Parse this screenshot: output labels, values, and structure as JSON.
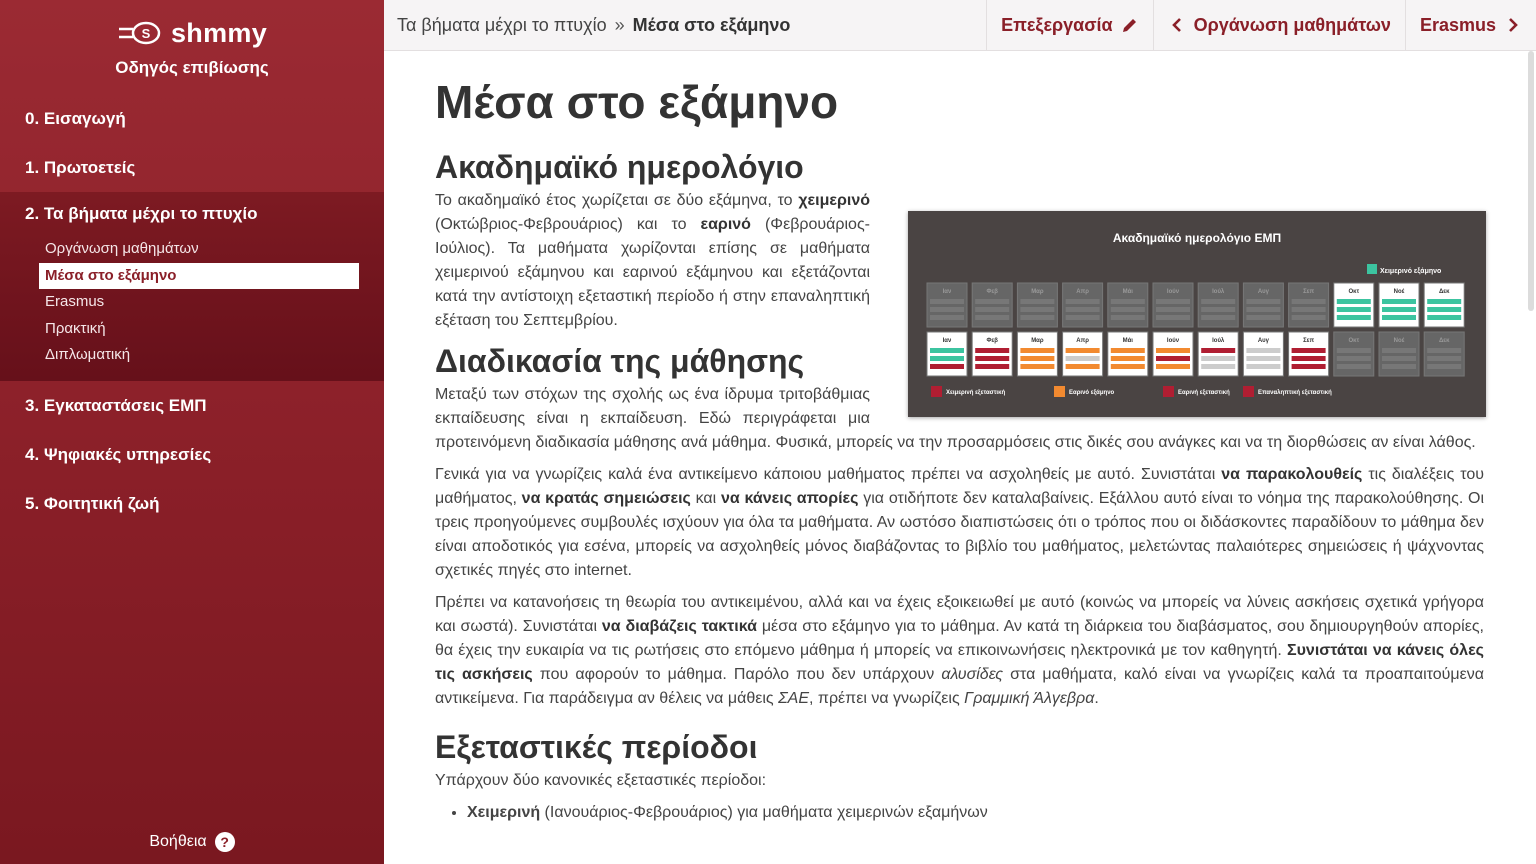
{
  "brand": {
    "name": "shmmy",
    "subtitle": "Οδηγός επιβίωσης"
  },
  "sidebar": {
    "items": [
      {
        "label": "0. Εισαγωγή"
      },
      {
        "label": "1. Πρωτοετείς"
      },
      {
        "label": "2. Τα βήματα μέχρι το πτυχίο",
        "children": [
          {
            "label": "Οργάνωση μαθημάτων"
          },
          {
            "label": "Μέσα στο εξάμηνο",
            "active": true
          },
          {
            "label": "Erasmus"
          },
          {
            "label": "Πρακτική"
          },
          {
            "label": "Διπλωματική"
          }
        ]
      },
      {
        "label": "3. Εγκαταστάσεις ΕΜΠ"
      },
      {
        "label": "4. Ψηφιακές υπηρεσίες"
      },
      {
        "label": "5. Φοιτητική ζωή"
      }
    ],
    "help": "Βοήθεια",
    "help_icon": "question-icon"
  },
  "topbar": {
    "breadcrumb_parent": "Τα βήματα μέχρι το πτυχίο",
    "breadcrumb_sep": "»",
    "breadcrumb_current": "Μέσα στο εξάμηνο",
    "edit": "Επεξεργασία",
    "prev": "Οργάνωση μαθημάτων",
    "next": "Erasmus"
  },
  "colors": {
    "brand": "#8a1f28",
    "teal": "#3cc4a0",
    "orange": "#f28a30",
    "red": "#b01e32"
  },
  "page": {
    "title": "Μέσα στο εξάμηνο",
    "sec1": {
      "heading": "Ακαδημαϊκό ημερολόγιο",
      "p1": [
        "Το ακαδημαϊκό έτος χωρίζεται σε δύο εξάμηνα, το ",
        "χειμερινό",
        " (Οκτώβριος-Φεβρουάριος) και το ",
        "εαρινό",
        " (Φεβρουάριος-Ιούλιος). Τα μαθήματα χωρίζονται επίσης σε μαθήματα χειμερινού εξάμηνου και εαρινού εξάμηνου και εξετάζονται κατά την αντίστοιχη εξεταστική περίοδο ή στην επαναληπτική εξέταση του Σεπτεμβρίου."
      ]
    },
    "figure": {
      "title": "Ακαδημαϊκό ημερολόγιο ΕΜΠ",
      "legend_top": "Χειμερινό εξάμηνο",
      "months": [
        "Ιαν",
        "Φεβ",
        "Μαρ",
        "Απρ",
        "Μάι",
        "Ιούν",
        "Ιούλ",
        "Αυγ",
        "Σεπ",
        "Οκτ",
        "Νοέ",
        "Δεκ"
      ],
      "legend_bottom": [
        "Χειμερινή εξεταστική",
        "Εαρινό εξάμηνο",
        "Εαρινή εξεταστική",
        "Επαναληπτική εξεταστική"
      ]
    },
    "sec2": {
      "heading": "Διαδικασία της μάθησης",
      "p1": "Μεταξύ των στόχων της σχολής ως ένα ίδρυμα τριτοβάθμιας εκπαίδευσης είναι η εκπαίδευση. Εδώ περιγράφεται μια προτεινόμενη διαδικασία μάθησης ανά μάθημα. Φυσικά, μπορείς να την προσαρμόσεις στις δικές σου ανάγκες και να τη διορθώσεις αν είναι λάθος.",
      "p2": [
        "Γενικά για να γνωρίζεις καλά ένα αντικείμενο κάποιου μαθήματος πρέπει να ασχοληθείς με αυτό. Συνιστάται ",
        "να παρακολουθείς",
        " τις διαλέξεις του μαθήματος, ",
        "να κρατάς σημειώσεις",
        " και ",
        "να κάνεις απορίες",
        " για οτιδήποτε δεν καταλαβαίνεις. Εξάλλου αυτό είναι το νόημα της παρακολούθησης. Οι τρεις προηγούμενες συμβουλές ισχύουν για όλα τα μαθήματα. Αν ωστόσο διαπιστώσεις ότι ο τρόπος που οι διδάσκοντες παραδίδουν το μάθημα δεν είναι αποδοτικός για εσένα, μπορείς να ασχοληθείς μόνος διαβάζοντας το βιβλίο του μαθήματος, μελετώντας παλαιότερες σημειώσεις ή ψάχνοντας σχετικές πηγές στο internet."
      ],
      "p3": [
        "Πρέπει να κατανοήσεις τη θεωρία του αντικειμένου, αλλά και να έχεις εξοικειωθεί με αυτό (κοινώς να μπορείς να λύνεις ασκήσεις σχετικά γρήγορα και σωστά). Συνιστάται ",
        "να διαβάζεις τακτικά",
        " μέσα στο εξάμηνο για το μάθημα. Αν κατά τη διάρκεια του διαβάσματος, σου δημιουργηθούν απορίες, θα έχεις την ευκαιρία να τις ρωτήσεις στο επόμενο μάθημα ή μπορείς να επικοινωνήσεις ηλεκτρονικά με τον καθηγητή. ",
        "Συνιστάται να κάνεις όλες τις ασκήσεις",
        " που αφορούν το μάθημα. Παρόλο που δεν υπάρχουν ",
        "αλυσίδες",
        " στα μαθήματα, καλό είναι να γνωρίζεις καλά τα προαπαιτούμενα αντικείμενα. Για παράδειγμα αν θέλεις να μάθεις ",
        "ΣΑΕ",
        ", πρέπει να γνωρίζεις ",
        "Γραμμική Άλγεβρα",
        "."
      ]
    },
    "sec3": {
      "heading": "Εξεταστικές περίοδοι",
      "intro": "Υπάρχουν δύο κανονικές εξεταστικές περίοδοι:",
      "bullet1": [
        "Χειμερινή",
        " (Ιανουάριος-Φεβρουάριος) για μαθήματα χειμερινών εξαμήνων"
      ]
    }
  }
}
